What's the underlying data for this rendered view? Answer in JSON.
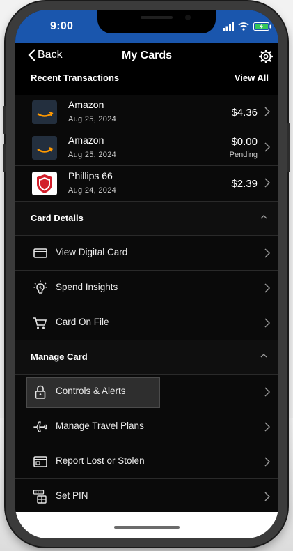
{
  "status_bar": {
    "time": "9:00",
    "color": "#1a56ad"
  },
  "nav": {
    "back_label": "Back",
    "title": "My Cards",
    "settings_icon": "gear-icon"
  },
  "recent": {
    "heading": "Recent Transactions",
    "view_all": "View All",
    "items": [
      {
        "merchant": "Amazon",
        "date": "Aug 25, 2024",
        "amount": "$4.36",
        "status": "",
        "logo": "amazon-logo"
      },
      {
        "merchant": "Amazon",
        "date": "Aug 25, 2024",
        "amount": "$0.00",
        "status": "Pending",
        "logo": "amazon-logo"
      },
      {
        "merchant": "Phillips 66",
        "date": "Aug 24, 2024",
        "amount": "$2.39",
        "status": "",
        "logo": "phillips66-logo"
      }
    ]
  },
  "card_details": {
    "heading": "Card Details",
    "items": [
      {
        "label": "View Digital Card",
        "icon": "credit-card-icon"
      },
      {
        "label": "Spend Insights",
        "icon": "lightbulb-icon"
      },
      {
        "label": "Card On File",
        "icon": "shopping-cart-icon"
      }
    ]
  },
  "manage_card": {
    "heading": "Manage Card",
    "items": [
      {
        "label": "Controls & Alerts",
        "icon": "lock-icon"
      },
      {
        "label": "Manage Travel Plans",
        "icon": "airplane-icon"
      },
      {
        "label": "Report Lost or Stolen",
        "icon": "card-alert-icon"
      },
      {
        "label": "Set PIN",
        "icon": "pin-keypad-icon"
      }
    ]
  }
}
